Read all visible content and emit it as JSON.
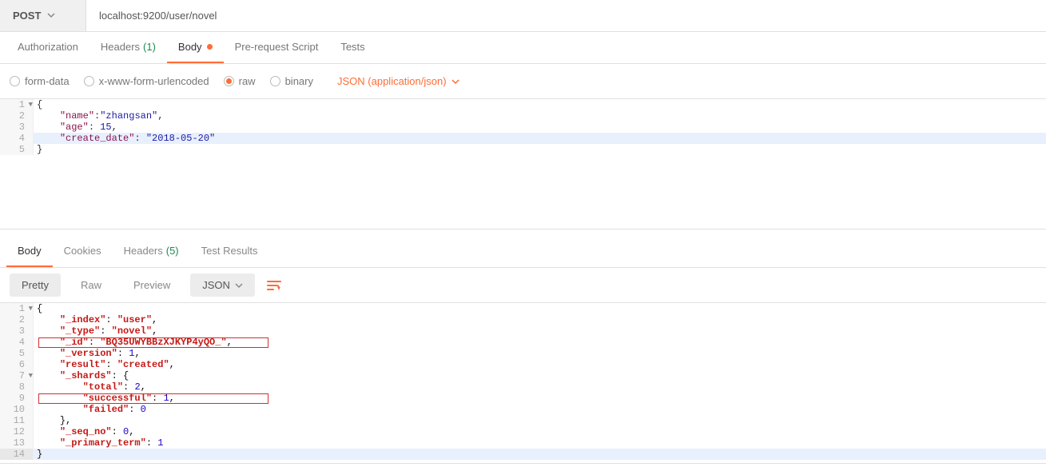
{
  "request": {
    "method": "POST",
    "url": "localhost:9200/user/novel"
  },
  "tabs": {
    "authorization": "Authorization",
    "headers": "Headers",
    "headers_count": "(1)",
    "body": "Body",
    "prerequest": "Pre-request Script",
    "tests": "Tests"
  },
  "body_opts": {
    "form_data": "form-data",
    "urlencoded": "x-www-form-urlencoded",
    "raw": "raw",
    "binary": "binary",
    "content_type": "JSON (application/json)"
  },
  "req_code": {
    "l1": "{",
    "l2k": "\"name\"",
    "l2p1": ":",
    "l2v": "\"zhangsan\"",
    "l2c": ",",
    "l3k": "\"age\"",
    "l3p1": ": ",
    "l3v": "15",
    "l3c": ",",
    "l4k": "\"create_date\"",
    "l4p1": ": ",
    "l4v": "\"2018-05-20\"",
    "l5": "}"
  },
  "gutter": {
    "n1": "1",
    "n2": "2",
    "n3": "3",
    "n4": "4",
    "n5": "5"
  },
  "resp_tabs": {
    "body": "Body",
    "cookies": "Cookies",
    "headers": "Headers",
    "headers_count": "(5)",
    "tests": "Test Results"
  },
  "view": {
    "pretty": "Pretty",
    "raw": "Raw",
    "preview": "Preview",
    "format": "JSON"
  },
  "resp_code": {
    "l1": "{",
    "l2k": "\"_index\"",
    "l2v": "\"user\"",
    "l3k": "\"_type\"",
    "l3v": "\"novel\"",
    "l4k": "\"_id\"",
    "l4v": "\"BQ35UWYBBzXJKYP4yQO_\"",
    "l5k": "\"_version\"",
    "l5v": "1",
    "l6k": "\"result\"",
    "l6v": "\"created\"",
    "l7k": "\"_shards\"",
    "l7v": "{",
    "l8k": "\"total\"",
    "l8v": "2",
    "l9k": "\"successful\"",
    "l9v": "1",
    "l10k": "\"failed\"",
    "l10v": "0",
    "l11": "}",
    "l12k": "\"_seq_no\"",
    "l12v": "0",
    "l13k": "\"_primary_term\"",
    "l13v": "1",
    "l14": "}"
  },
  "rgutter": {
    "n1": "1",
    "n2": "2",
    "n3": "3",
    "n4": "4",
    "n5": "5",
    "n6": "6",
    "n7": "7",
    "n8": "8",
    "n9": "9",
    "n10": "10",
    "n11": "11",
    "n12": "12",
    "n13": "13",
    "n14": "14"
  }
}
